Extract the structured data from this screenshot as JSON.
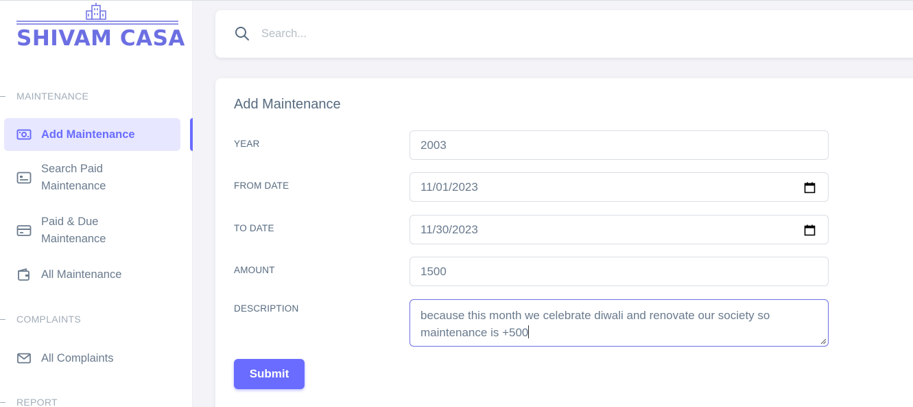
{
  "brand": {
    "name": "SHIVAM CASA"
  },
  "sidebar": {
    "sections": [
      {
        "header": "MAINTENANCE"
      },
      {
        "header": "COMPLAINTS"
      },
      {
        "header": "REPORT"
      }
    ],
    "items": [
      {
        "line1": "Add Maintenance",
        "line2": "",
        "icon": "money-icon",
        "active": true
      },
      {
        "line1": "Search Paid",
        "line2": "Maintenance",
        "icon": "id-card-icon"
      },
      {
        "line1": "Paid & Due",
        "line2": "Maintenance",
        "icon": "credit-card-icon"
      },
      {
        "line1": "All Maintenance",
        "line2": "",
        "icon": "wallet-icon"
      },
      {
        "line1": "All Complaints",
        "line2": "",
        "icon": "mail-icon"
      }
    ]
  },
  "search": {
    "placeholder": "Search..."
  },
  "form": {
    "title": "Add Maintenance",
    "fields": {
      "year": {
        "label": "YEAR",
        "value": "2003"
      },
      "from_date": {
        "label": "FROM DATE",
        "value": "11/01/2023"
      },
      "to_date": {
        "label": "TO DATE",
        "value": "11/30/2023"
      },
      "amount": {
        "label": "AMOUNT",
        "value": "1500"
      },
      "description": {
        "label": "DESCRIPTION",
        "line1": "because this month we celebrate diwali and renovate our society so",
        "line2": "maintenance is +500"
      }
    },
    "submit_label": "Submit"
  },
  "colors": {
    "accent": "#696cff",
    "active_bg": "#e7e7ff",
    "text": "#566a7f",
    "muted": "#a1acb8"
  }
}
